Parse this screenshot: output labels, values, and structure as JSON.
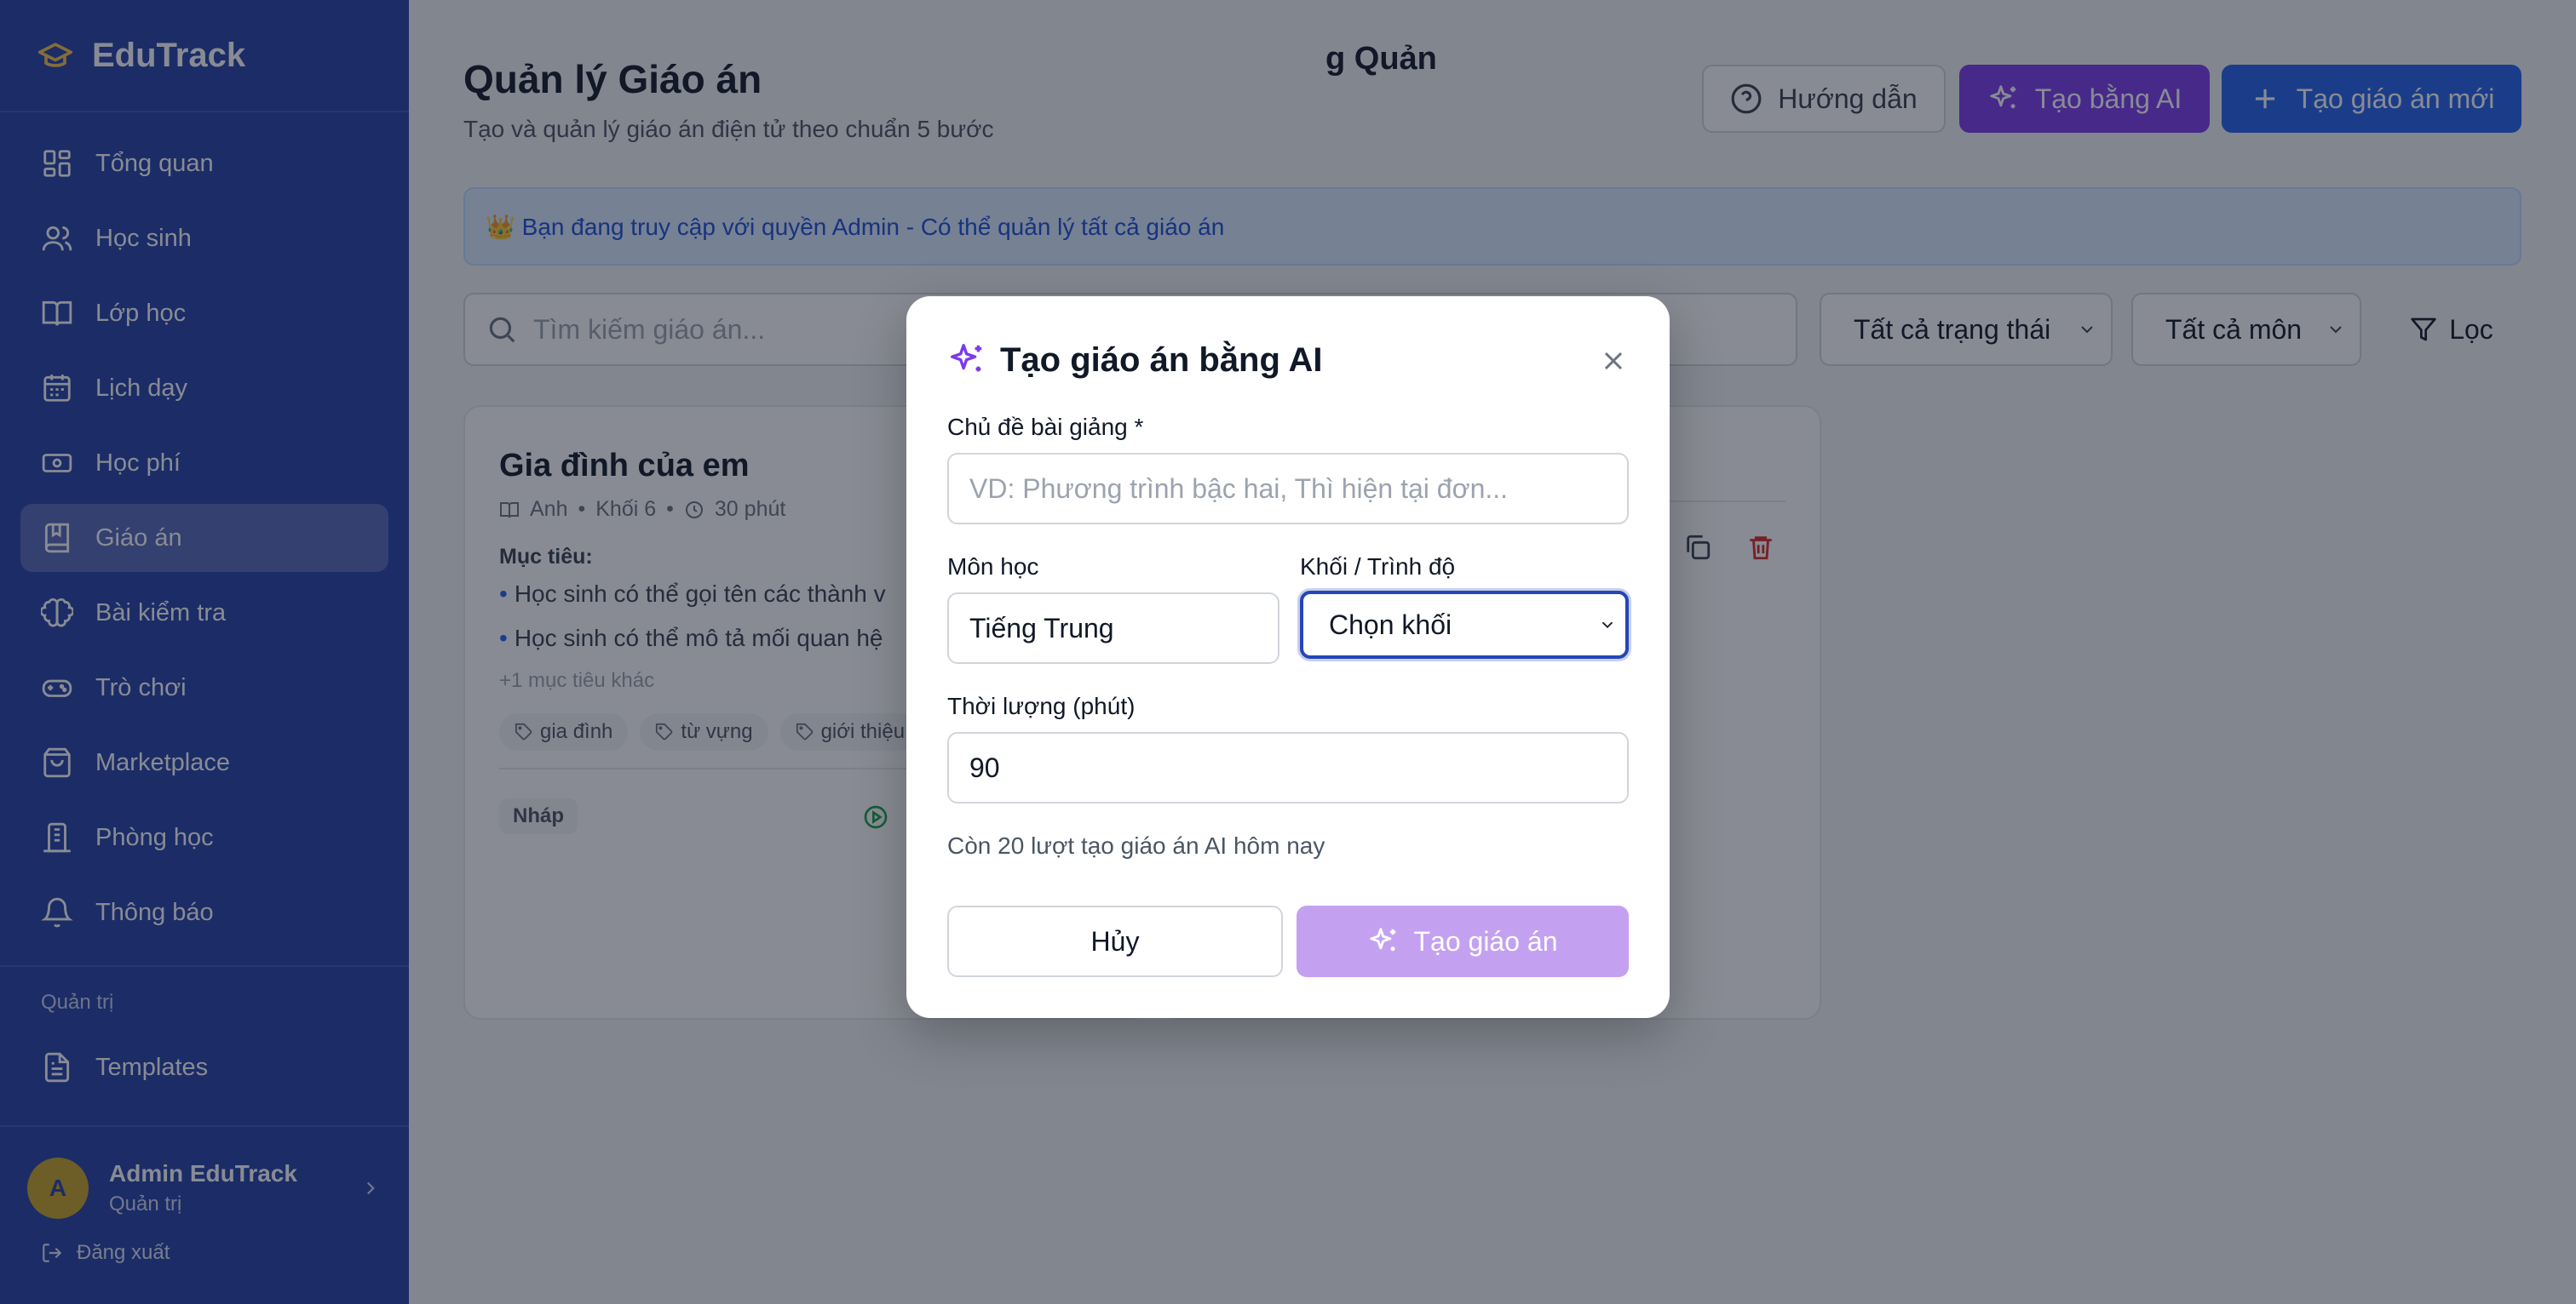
{
  "app": {
    "name": "EduTrack"
  },
  "sidebar": {
    "items": [
      {
        "label": "Tổng quan",
        "icon": "dashboard-icon",
        "active": false
      },
      {
        "label": "Học sinh",
        "icon": "users-icon",
        "active": false
      },
      {
        "label": "Lớp học",
        "icon": "book-open-icon",
        "active": false
      },
      {
        "label": "Lịch dạy",
        "icon": "calendar-icon",
        "active": false
      },
      {
        "label": "Học phí",
        "icon": "banknote-icon",
        "active": false
      },
      {
        "label": "Giáo án",
        "icon": "notebook-icon",
        "active": true
      },
      {
        "label": "Bài kiểm tra",
        "icon": "brain-icon",
        "active": false
      },
      {
        "label": "Trò chơi",
        "icon": "gamepad-icon",
        "active": false
      },
      {
        "label": "Marketplace",
        "icon": "shopping-bag-icon",
        "active": false
      },
      {
        "label": "Phòng học",
        "icon": "building-icon",
        "active": false
      },
      {
        "label": "Thông báo",
        "icon": "bell-icon",
        "active": false
      }
    ],
    "section_label": "Quản trị",
    "admin_items": [
      {
        "label": "Templates",
        "icon": "file-text-icon"
      }
    ],
    "user": {
      "initial": "A",
      "name": "Admin EduTrack",
      "role": "Quản trị"
    },
    "logout_label": "Đăng xuất"
  },
  "header": {
    "title": "Quản lý Giáo án",
    "subtitle": "Tạo và quản lý giáo án điện tử theo chuẩn 5 bước",
    "help_label": "Hướng dẫn",
    "ai_label": "Tạo bằng AI",
    "new_label": "Tạo giáo án mới"
  },
  "banner": {
    "text": "👑 Bạn đang truy cập với quyền Admin - Có thể quản lý tất cả giáo án"
  },
  "filters": {
    "search_placeholder": "Tìm kiếm giáo án...",
    "status_value": "Tất cả trạng thái",
    "subject_value": "Tất cả môn",
    "filter_label": "Lọc"
  },
  "cards": [
    {
      "title": "Gia đình của em",
      "subject": "Anh",
      "grade": "Khối 6",
      "duration": "30 phút",
      "goal_label": "Mục tiêu:",
      "goals": [
        "Học sinh có thể gọi tên các thành v",
        "Học sinh có thể mô tả mối quan hệ"
      ],
      "more": "+1 mục tiêu khác",
      "tags": [
        "gia đình",
        "từ vựng",
        "giới thiệu"
      ],
      "status": "Nháp"
    },
    {
      "title_fragment": "g Quản"
    }
  ],
  "modal": {
    "title": "Tạo giáo án bằng AI",
    "topic_label": "Chủ đề bài giảng *",
    "topic_placeholder": "VD: Phương trình bậc hai, Thì hiện tại đơn...",
    "subject_label": "Môn học",
    "subject_value": "Tiếng Trung",
    "grade_label": "Khối / Trình độ",
    "grade_value": "Chọn khối",
    "duration_label": "Thời lượng (phút)",
    "duration_value": "90",
    "quota_note": "Còn 20 lượt tạo giáo án AI hôm nay",
    "cancel_label": "Hủy",
    "submit_label": "Tạo giáo án"
  },
  "colors": {
    "sidebar_bg": "#2541a6",
    "primary": "#2563eb",
    "ai_purple": "#7c3aed",
    "submit_disabled": "#c4a1f0",
    "danger": "#dc2626"
  }
}
